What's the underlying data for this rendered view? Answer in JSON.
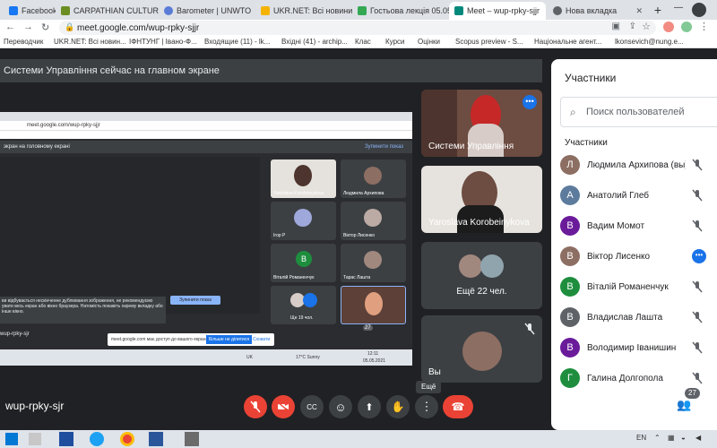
{
  "tabs": [
    {
      "label": "Facebook",
      "color": "#1877f2"
    },
    {
      "label": "CARPATHIAN CULTURAL",
      "color": "#6b8e23"
    },
    {
      "label": "Barometer | UNWTO",
      "color": "#5a7bd6"
    },
    {
      "label": "UKR.NET: Всі новини Ук",
      "color": "#f5b300"
    },
    {
      "label": "Гостьова лекція 05.05.",
      "color": "#34a853"
    },
    {
      "label": "Meet – wup-rpky-sjjr",
      "color": "#00897b"
    },
    {
      "label": "Нова вкладка",
      "color": "#5f6368"
    }
  ],
  "address": {
    "url": "meet.google.com/wup-rpky-sjjr"
  },
  "bookmarks": [
    "Переводчик",
    "UKR.NET: Всі новин...",
    "ІФНТУНГ | Івано-Ф...",
    "Входящие (11) - lk...",
    "Вхідні (41) - archip...",
    "Клас",
    "Курси",
    "Оцінки",
    "Scopus preview - S...",
    "Національне агент...",
    "lkonsevich@nung.e..."
  ],
  "presenting_label": "Системи Управління сейчас на главном экране",
  "shared_screen": {
    "url": "meet.google.com/wup-rpky-sjjr",
    "header": "экран на головному екрані",
    "stop_button": "Зупинити показ",
    "warning": "ви відбувається нескінченне дублювання зображення, не рекомендуємо увати весь екран або вікно браузера. Натомість покажіть окрему вкладку або інше вікно.",
    "warning_button": "Зупинити показ",
    "meeting_code": "wup-rpky-sjr",
    "notice_text": "meet.google.com має доступ до вашого екрана.",
    "notice_button": "Більше не ділитися",
    "notice_hide": "Сховати",
    "weather": "17°C Sunny",
    "time": "12:11",
    "date": "05.05.2021",
    "lang": "UK",
    "mini_tiles": [
      {
        "name": "Yaroslava Korobeinykova"
      },
      {
        "name": "Людмила Архипова"
      },
      {
        "name": "Ігор Р"
      },
      {
        "name": "Віктор Лисенко"
      },
      {
        "name": "Віталій Романенчук",
        "initial": "В"
      },
      {
        "name": "Тарас Лашта"
      },
      {
        "name": "Ще 19 чол."
      },
      {
        "name": ""
      }
    ],
    "participants_badge": "27"
  },
  "tiles": {
    "presenter": "Системи Управління",
    "yaroslava": "Yaroslava Korobeinykova",
    "more": "Ещё 22 чел.",
    "self": "Вы"
  },
  "people": {
    "title": "Участники",
    "search_placeholder": "Поиск пользователей",
    "section": "Участники",
    "list": [
      {
        "name": "Людмила Архипова (вы)",
        "initial": "Л",
        "color": "#8d6e63",
        "photo": true
      },
      {
        "name": "Анатолий Глеб",
        "initial": "А",
        "color": "#5d7b9d",
        "photo": true
      },
      {
        "name": "Вадим Момот",
        "initial": "В",
        "color": "#6a1b9a"
      },
      {
        "name": "Віктор Лисенко",
        "initial": "В",
        "color": "#8d6e63",
        "photo": true,
        "more": true
      },
      {
        "name": "Віталій Романенчук",
        "initial": "В",
        "color": "#1e8e3e"
      },
      {
        "name": "Владислав Лашта",
        "initial": "В",
        "color": "#5f6368"
      },
      {
        "name": "Володимир Іванишин",
        "initial": "В",
        "color": "#6a1b9a"
      },
      {
        "name": "Галина Долгопола",
        "initial": "Г",
        "color": "#1e8e3e"
      }
    ]
  },
  "bottom": {
    "meeting_code": "wup-rpky-sjr",
    "tooltip": "Ещё",
    "participant_count": "27"
  },
  "taskbar": {
    "lang": "EN"
  },
  "colors": {
    "meet_bg": "#202124",
    "danger": "#ea4335",
    "accent": "#1a73e8"
  }
}
